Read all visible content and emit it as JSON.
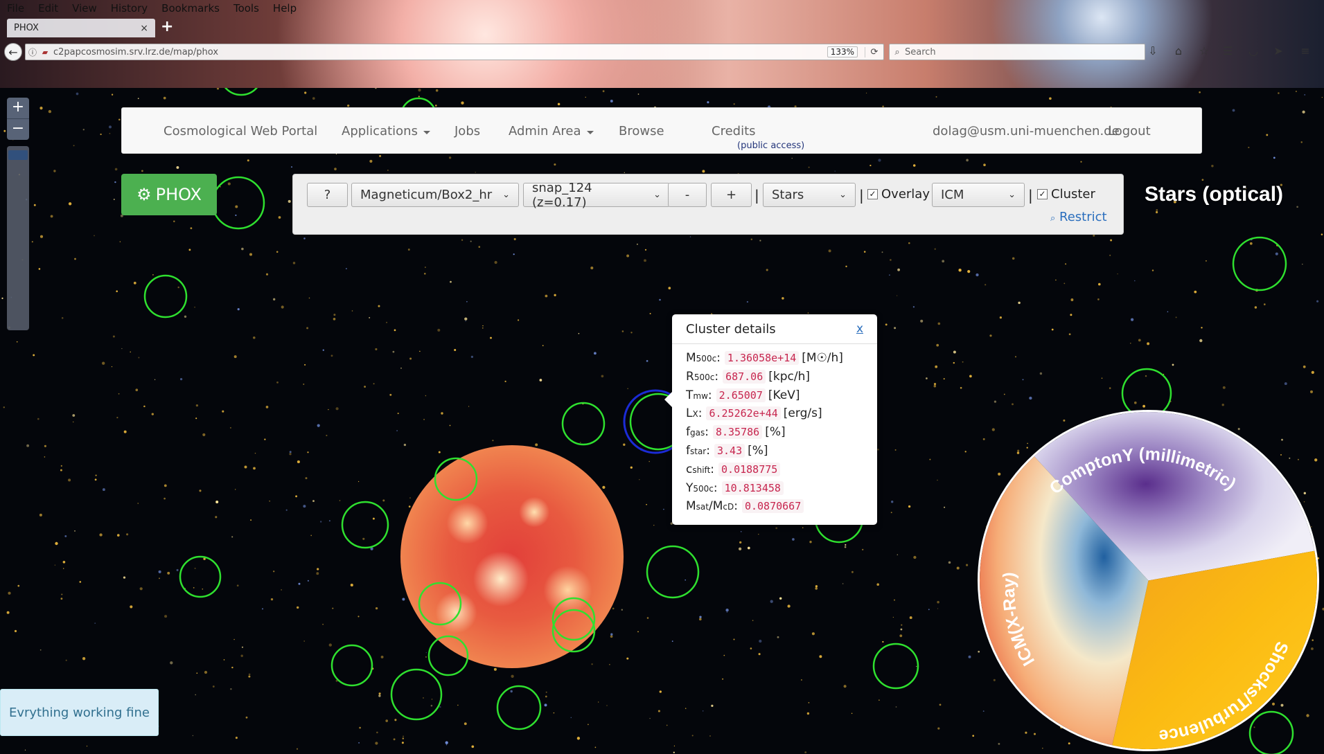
{
  "browser": {
    "menus": [
      "File",
      "Edit",
      "View",
      "History",
      "Bookmarks",
      "Tools",
      "Help"
    ],
    "tab_title": "PHOX",
    "tab_close": "×",
    "new_tab": "+",
    "url": "c2papcosmosim.srv.lrz.de/map/phox",
    "url_host_bold": "lrz.de",
    "zoom": "133%",
    "search_placeholder": "Search"
  },
  "map_controls": {
    "zoom_in": "+",
    "zoom_out": "−"
  },
  "nav": {
    "brand": "Cosmological Web Portal",
    "applications": "Applications",
    "jobs": "Jobs",
    "admin": "Admin Area",
    "browse": "Browse",
    "browse_sub": "(public access)",
    "credits": "Credits",
    "user": "dolag@usm.uni-muenchen.de",
    "logout": "Logout"
  },
  "phox_button": "PHOX",
  "controls": {
    "help": "?",
    "simulation": "Magneticum/Box2_hr",
    "snapshot": "snap_124 (z=0.17)",
    "minus": "-",
    "plus": "+",
    "layer": "Stars",
    "overlay_label": "Overlay",
    "overlay_checked": true,
    "overlay_layer": "ICM",
    "cluster_label": "Cluster",
    "cluster_checked": true,
    "restrict": "Restrict",
    "pipe": "|"
  },
  "layer_title": "Stars (optical)",
  "popup": {
    "title": "Cluster details",
    "close": "x",
    "rows": [
      {
        "sym": "M",
        "sub": "500c",
        "value": "1.36058e+14",
        "unit": "[M☉/h]"
      },
      {
        "sym": "R",
        "sub": "500c",
        "value": "687.06",
        "unit": "[kpc/h]"
      },
      {
        "sym": "T",
        "sub": "mw",
        "value": "2.65007",
        "unit": "[KeV]"
      },
      {
        "sym": "L",
        "sub": "X",
        "value": "6.25262e+44",
        "unit": "[erg/s]"
      },
      {
        "sym": "f",
        "sub": "gas",
        "value": "8.35786",
        "unit": "[%]"
      },
      {
        "sym": "f",
        "sub": "star",
        "value": "3.43",
        "unit": "[%]"
      },
      {
        "sym": "c",
        "sub": "shift",
        "value": "0.0188775",
        "unit": ""
      },
      {
        "sym": "Y",
        "sub": "500c",
        "value": "10.813458",
        "unit": ""
      },
      {
        "sym": "M",
        "sub": "sat",
        "sym2": "/M",
        "sub2": "cD",
        "value": "0.0870667",
        "unit": ""
      }
    ]
  },
  "pie_labels": {
    "compton": "ComptonY (millimetric)",
    "icm": "ICM(X-Ray)",
    "shocks": "Shocks/Turbulence"
  },
  "status": "Evrything working fine",
  "colors": {
    "cluster_ring": "#2fe02f",
    "selected_ring": "#1b2bd6",
    "phox_green": "#4cb050",
    "link_blue": "#2a6ebd",
    "code_red": "#c7254e"
  }
}
